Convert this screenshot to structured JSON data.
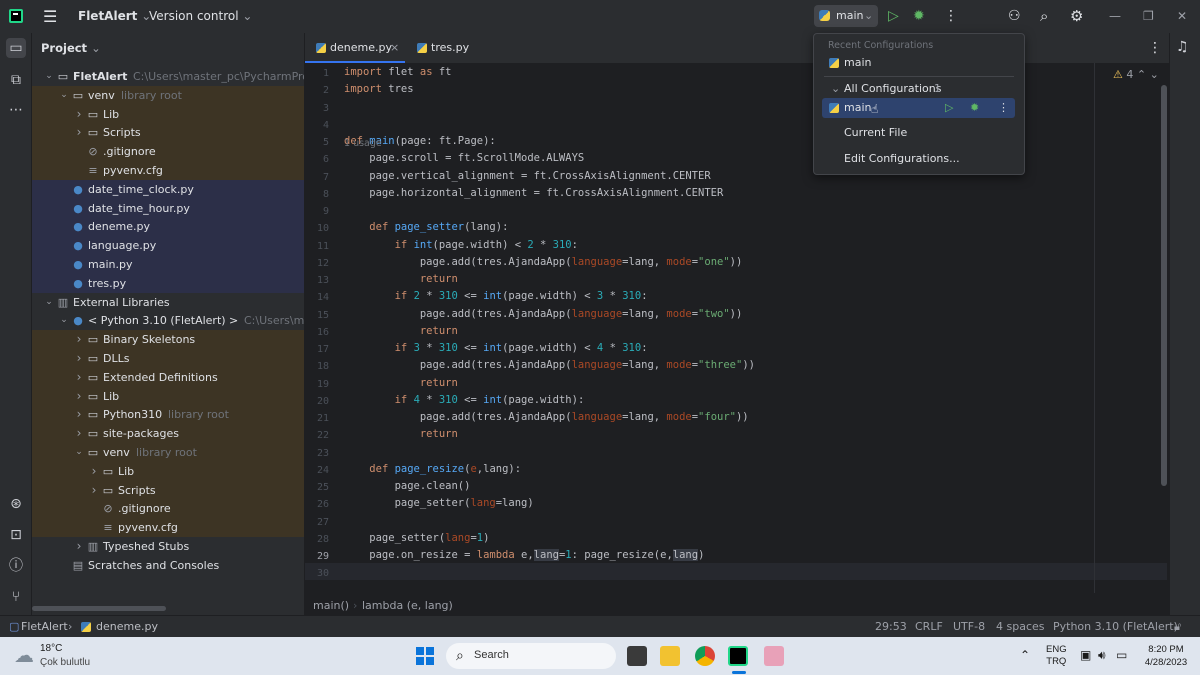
{
  "titlebar": {
    "project_name": "FletAlert",
    "vcs": "Version control",
    "run_config": "main"
  },
  "project_panel": {
    "title": "Project",
    "tree": [
      {
        "indent": 0,
        "arrow": "down",
        "icon": "folder",
        "name": "FletAlert",
        "hint": "C:\\Users\\master_pc\\PycharmProjects",
        "bold": true,
        "row_style": "none"
      },
      {
        "indent": 1,
        "arrow": "down",
        "icon": "folder",
        "name": "venv",
        "hint": "library root",
        "row_style": "orange"
      },
      {
        "indent": 2,
        "arrow": "right",
        "icon": "folder",
        "name": "Lib",
        "hint": "",
        "row_style": "orange"
      },
      {
        "indent": 2,
        "arrow": "right",
        "icon": "folder",
        "name": "Scripts",
        "hint": "",
        "row_style": "orange"
      },
      {
        "indent": 2,
        "arrow": "",
        "icon": "ignore",
        "name": ".gitignore",
        "hint": "",
        "row_style": "orange"
      },
      {
        "indent": 2,
        "arrow": "",
        "icon": "text",
        "name": "pyvenv.cfg",
        "hint": "",
        "row_style": "orange"
      },
      {
        "indent": 1,
        "arrow": "",
        "icon": "py",
        "name": "date_time_clock.py",
        "hint": "",
        "row_style": "blue"
      },
      {
        "indent": 1,
        "arrow": "",
        "icon": "py",
        "name": "date_time_hour.py",
        "hint": "",
        "row_style": "blue"
      },
      {
        "indent": 1,
        "arrow": "",
        "icon": "py",
        "name": "deneme.py",
        "hint": "",
        "row_style": "blue"
      },
      {
        "indent": 1,
        "arrow": "",
        "icon": "py",
        "name": "language.py",
        "hint": "",
        "row_style": "blue"
      },
      {
        "indent": 1,
        "arrow": "",
        "icon": "py",
        "name": "main.py",
        "hint": "",
        "row_style": "blue"
      },
      {
        "indent": 1,
        "arrow": "",
        "icon": "py",
        "name": "tres.py",
        "hint": "",
        "row_style": "blue"
      },
      {
        "indent": 0,
        "arrow": "down",
        "icon": "lib",
        "name": "External Libraries",
        "hint": "",
        "row_style": "none"
      },
      {
        "indent": 1,
        "arrow": "down",
        "icon": "py",
        "name": "< Python 3.10 (FletAlert) >",
        "hint": "C:\\Users\\master_",
        "row_style": "none"
      },
      {
        "indent": 2,
        "arrow": "right",
        "icon": "folder",
        "name": "Binary Skeletons",
        "hint": "",
        "row_style": "orange"
      },
      {
        "indent": 2,
        "arrow": "right",
        "icon": "folder",
        "name": "DLLs",
        "hint": "",
        "row_style": "orange"
      },
      {
        "indent": 2,
        "arrow": "right",
        "icon": "folder",
        "name": "Extended Definitions",
        "hint": "",
        "row_style": "orange"
      },
      {
        "indent": 2,
        "arrow": "right",
        "icon": "folder",
        "name": "Lib",
        "hint": "",
        "row_style": "orange"
      },
      {
        "indent": 2,
        "arrow": "right",
        "icon": "folder",
        "name": "Python310",
        "hint": "library root",
        "row_style": "orange"
      },
      {
        "indent": 2,
        "arrow": "right",
        "icon": "folder",
        "name": "site-packages",
        "hint": "",
        "row_style": "orange"
      },
      {
        "indent": 2,
        "arrow": "down",
        "icon": "folder",
        "name": "venv",
        "hint": "library root",
        "row_style": "orange"
      },
      {
        "indent": 3,
        "arrow": "right",
        "icon": "folder",
        "name": "Lib",
        "hint": "",
        "row_style": "orange"
      },
      {
        "indent": 3,
        "arrow": "right",
        "icon": "folder",
        "name": "Scripts",
        "hint": "",
        "row_style": "orange"
      },
      {
        "indent": 3,
        "arrow": "",
        "icon": "ignore",
        "name": ".gitignore",
        "hint": "",
        "row_style": "orange"
      },
      {
        "indent": 3,
        "arrow": "",
        "icon": "text",
        "name": "pyvenv.cfg",
        "hint": "",
        "row_style": "orange"
      },
      {
        "indent": 2,
        "arrow": "right",
        "icon": "lib",
        "name": "Typeshed Stubs",
        "hint": "",
        "row_style": "none"
      },
      {
        "indent": 1,
        "arrow": "",
        "icon": "scratch",
        "name": "Scratches and Consoles",
        "hint": "",
        "row_style": "none"
      }
    ]
  },
  "editor": {
    "tabs": [
      {
        "label": "deneme.py",
        "active": true,
        "closable": true
      },
      {
        "label": "tres.py",
        "active": false,
        "closable": false
      }
    ],
    "warnings": "4",
    "usage_hint": "1 usage",
    "lines": [
      {
        "n": "1",
        "html": "<span class='kw'>import</span> flet <span class='kw'>as</span> ft"
      },
      {
        "n": "2",
        "html": "<span class='kw'>import</span> tres"
      },
      {
        "n": "3",
        "html": ""
      },
      {
        "n": "4",
        "html": ""
      },
      {
        "n": "5",
        "html": "<span class='kw'>def</span> <span class='fn'>main</span>(page: ft.Page):"
      },
      {
        "n": "6",
        "html": "    page.scroll = ft.ScrollMode.ALWAYS"
      },
      {
        "n": "7",
        "html": "    page.vertical_alignment = ft.CrossAxisAlignment.CENTER"
      },
      {
        "n": "8",
        "html": "    page.horizontal_alignment = ft.CrossAxisAlignment.CENTER"
      },
      {
        "n": "9",
        "html": ""
      },
      {
        "n": "10",
        "html": "    <span class='kw'>def</span> <span class='fn'>page_setter</span>(lang):"
      },
      {
        "n": "11",
        "html": "        <span class='kw'>if</span> <span class='fn'>int</span>(page.width) &lt; <span class='num'>2</span> * <span class='num'>310</span>:"
      },
      {
        "n": "12",
        "html": "            page.add(tres.AjandaApp(<span class='param'>language</span>=lang, <span class='param'>mode</span>=<span class='str'>\"one\"</span>))"
      },
      {
        "n": "13",
        "html": "            <span class='kw'>return</span>"
      },
      {
        "n": "14",
        "html": "        <span class='kw'>if</span> <span class='num'>2</span> * <span class='num'>310</span> &lt;= <span class='fn'>int</span>(page.width) &lt; <span class='num'>3</span> * <span class='num'>310</span>:"
      },
      {
        "n": "15",
        "html": "            page.add(tres.AjandaApp(<span class='param'>language</span>=lang, <span class='param'>mode</span>=<span class='str'>\"two\"</span>))"
      },
      {
        "n": "16",
        "html": "            <span class='kw'>return</span>"
      },
      {
        "n": "17",
        "html": "        <span class='kw'>if</span> <span class='num'>3</span> * <span class='num'>310</span> &lt;= <span class='fn'>int</span>(page.width) &lt; <span class='num'>4</span> * <span class='num'>310</span>:"
      },
      {
        "n": "18",
        "html": "            page.add(tres.AjandaApp(<span class='param'>language</span>=lang, <span class='param'>mode</span>=<span class='str'>\"three\"</span>))"
      },
      {
        "n": "19",
        "html": "            <span class='kw'>return</span>"
      },
      {
        "n": "20",
        "html": "        <span class='kw'>if</span> <span class='num'>4</span> * <span class='num'>310</span> &lt;= <span class='fn'>int</span>(page.width):"
      },
      {
        "n": "21",
        "html": "            page.add(tres.AjandaApp(<span class='param'>language</span>=lang, <span class='param'>mode</span>=<span class='str'>\"four\"</span>))"
      },
      {
        "n": "22",
        "html": "            <span class='kw'>return</span>"
      },
      {
        "n": "23",
        "html": ""
      },
      {
        "n": "24",
        "html": "    <span class='kw'>def</span> <span class='fn'>page_resize</span>(<span class='param'>e</span>,lang):"
      },
      {
        "n": "25",
        "html": "        page.clean()"
      },
      {
        "n": "26",
        "html": "        page_setter(<span class='param'>lang</span>=lang)"
      },
      {
        "n": "27",
        "html": ""
      },
      {
        "n": "28",
        "html": "    page_setter(<span class='param'>lang</span>=<span class='num'>1</span>)"
      },
      {
        "n": "29",
        "html": "    page.on_resize = <span class='kw'>lambda</span> e,<span class='hl'>lang</span>=<span class='num'>1</span>: page_resize(e,<span class='hl'>lang</span>)"
      },
      {
        "n": "30",
        "html": ""
      }
    ],
    "breadcrumb": [
      "main()",
      "lambda (e, lang)"
    ]
  },
  "run_popup": {
    "recent_header": "Recent Configurations",
    "recent_item": "main",
    "all_configs": "All Configurations",
    "all_count": "1",
    "selected_item": "main",
    "current_file": "Current File",
    "edit_configs": "Edit Configurations..."
  },
  "statusbar": {
    "path_project": "FletAlert",
    "path_file": "deneme.py",
    "position": "29:53",
    "line_sep": "CRLF",
    "encoding": "UTF-8",
    "indent": "4 spaces",
    "interpreter": "Python 3.10 (FletAlert)"
  },
  "taskbar": {
    "weather_temp": "18°C",
    "weather_text": "Çok bulutlu",
    "search_placeholder": "Search",
    "lang_top": "ENG",
    "lang_bottom": "TRQ",
    "time": "8:20 PM",
    "date": "4/28/2023"
  },
  "colors": {
    "row_orange": "#3d3424",
    "row_blue": "#2c2f48",
    "popup_selected": "#2e436e",
    "run_green": "#5fb865"
  }
}
